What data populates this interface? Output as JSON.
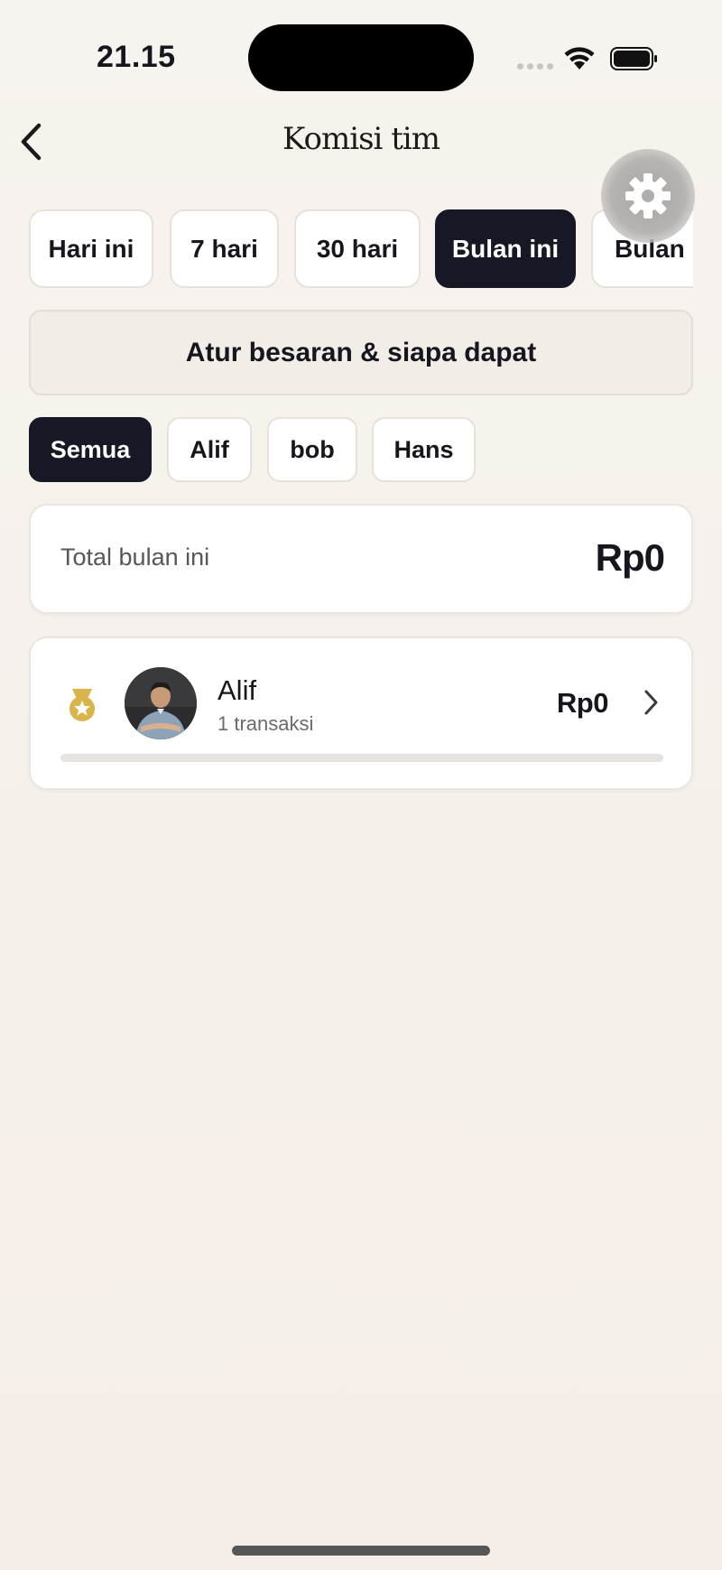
{
  "status_bar": {
    "time": "21.15"
  },
  "header": {
    "title": "Komisi tim"
  },
  "icons": {
    "back": "chevron-left-icon",
    "settings": "gear-icon",
    "wifi": "wifi-icon",
    "battery": "battery-icon",
    "medal": "medal-icon",
    "row_chevron": "chevron-right-icon"
  },
  "period_filters": {
    "items": [
      "Hari ini",
      "7 hari",
      "30 hari",
      "Bulan ini",
      "Bulan lalu"
    ],
    "selected": "Bulan ini"
  },
  "settings_button": {
    "label": "Atur besaran & siapa dapat"
  },
  "member_filters": {
    "items": [
      "Semua",
      "Alif",
      "bob",
      "Hans"
    ],
    "selected": "Semua"
  },
  "total": {
    "label": "Total bulan ini",
    "value": "Rp0"
  },
  "members": [
    {
      "name": "Alif",
      "transactions": "1 transaksi",
      "amount": "Rp0",
      "progress": 0
    }
  ],
  "colors": {
    "accent": "#171826",
    "background": "#f5efea",
    "medal": "#d9b44a"
  }
}
